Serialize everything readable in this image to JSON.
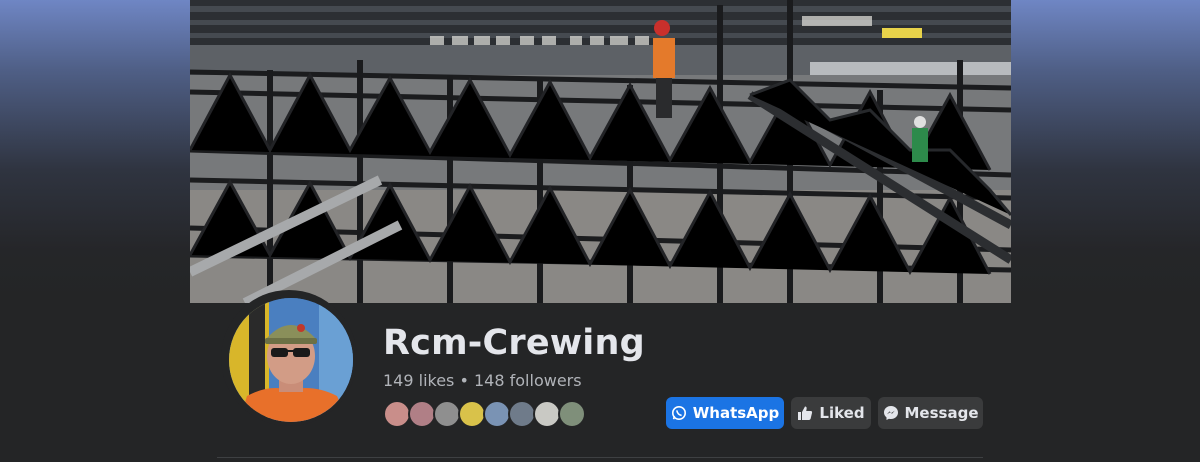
{
  "page": {
    "name": "Rcm-Crewing",
    "stats": "149 likes • 148 followers"
  },
  "actions": {
    "whatsapp_label": "WhatsApp",
    "liked_label": "Liked",
    "message_label": "Message"
  },
  "colors": {
    "primary_button": "#1b74e4",
    "secondary_button": "#3a3b3c",
    "background": "#242526",
    "name_text": "#e4e6eb",
    "muted_text": "#b0b3b8"
  },
  "icons": {
    "whatsapp": "whatsapp-icon",
    "liked": "thumbs-up-icon",
    "message": "messenger-icon"
  }
}
